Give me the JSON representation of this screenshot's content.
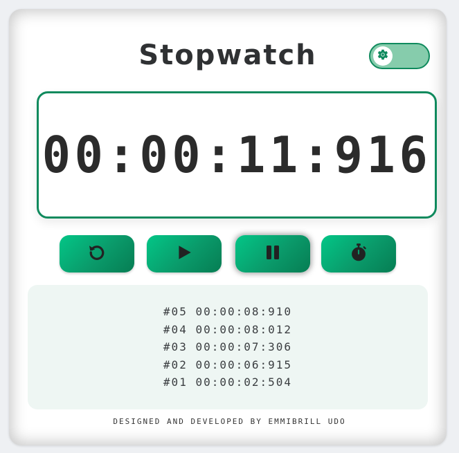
{
  "app": {
    "title": "Stopwatch",
    "accent_color": "#0f8a5d",
    "button_color": "#03b07a"
  },
  "theme_toggle": {
    "icon": "gear-icon",
    "state": "on"
  },
  "display": {
    "time": "00:00:11:916"
  },
  "controls": [
    {
      "name": "reset",
      "icon": "reset-icon"
    },
    {
      "name": "start",
      "icon": "play-icon"
    },
    {
      "name": "pause",
      "icon": "pause-icon"
    },
    {
      "name": "lap",
      "icon": "stopwatch-icon"
    }
  ],
  "laps": [
    {
      "label": "#05",
      "time": "00:00:08:910"
    },
    {
      "label": "#04",
      "time": "00:00:08:012"
    },
    {
      "label": "#03",
      "time": "00:00:07:306"
    },
    {
      "label": "#02",
      "time": "00:00:06:915"
    },
    {
      "label": "#01",
      "time": "00:00:02:504"
    }
  ],
  "footer": {
    "credit": "DESIGNED AND DEVELOPED BY EMMIBRILL UDO"
  }
}
